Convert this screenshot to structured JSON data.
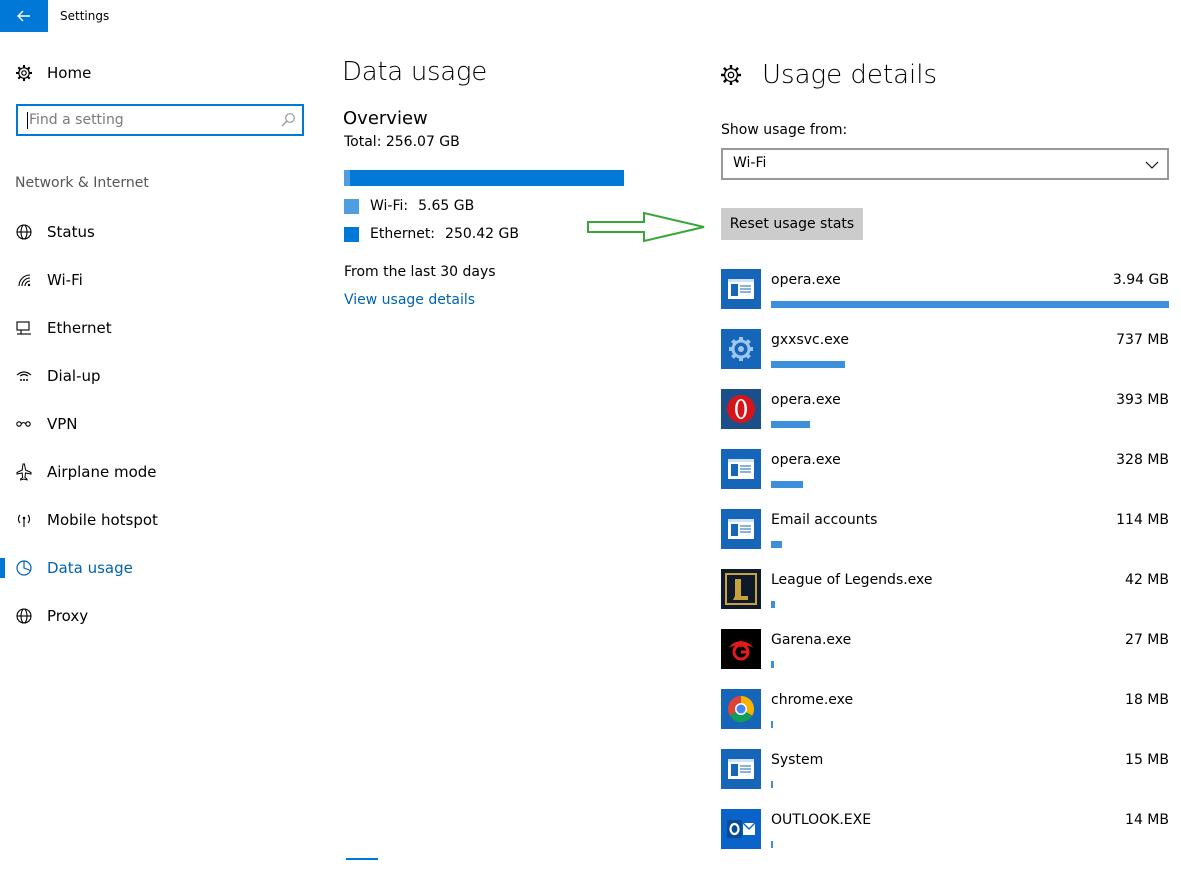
{
  "window": {
    "title": "Settings"
  },
  "nav": {
    "home_label": "Home",
    "search_placeholder": "Find a setting",
    "section_label": "Network & Internet",
    "items": [
      {
        "label": "Status",
        "icon": "globe-icon",
        "active": false
      },
      {
        "label": "Wi-Fi",
        "icon": "wifi-icon",
        "active": false
      },
      {
        "label": "Ethernet",
        "icon": "ethernet-icon",
        "active": false
      },
      {
        "label": "Dial-up",
        "icon": "dialup-icon",
        "active": false
      },
      {
        "label": "VPN",
        "icon": "vpn-icon",
        "active": false
      },
      {
        "label": "Airplane mode",
        "icon": "airplane-icon",
        "active": false
      },
      {
        "label": "Mobile hotspot",
        "icon": "hotspot-icon",
        "active": false
      },
      {
        "label": "Data usage",
        "icon": "pie-chart-icon",
        "active": true
      },
      {
        "label": "Proxy",
        "icon": "globe-icon",
        "active": false
      }
    ]
  },
  "data_usage": {
    "title": "Data usage",
    "overview_label": "Overview",
    "total": "Total: 256.07 GB",
    "wifi_fraction": 0.022,
    "legend": [
      {
        "key": "Wi-Fi:",
        "value": "5.65 GB",
        "color": "#4f9fe0"
      },
      {
        "key": "Ethernet:",
        "value": "250.42 GB",
        "color": "#0078d7"
      }
    ],
    "period": "From the last 30 days",
    "view_details_link": "View usage details"
  },
  "details": {
    "title": "Usage details",
    "show_from_label": "Show usage from:",
    "network_selected": "Wi-Fi",
    "reset_button": "Reset usage stats",
    "apps": [
      {
        "name": "opera.exe",
        "size": "3.94 GB",
        "fraction": 1.0,
        "icon": "window-app-icon"
      },
      {
        "name": "gxxsvc.exe",
        "size": "737 MB",
        "fraction": 0.185,
        "icon": "gear-app-icon"
      },
      {
        "name": "opera.exe",
        "size": "393 MB",
        "fraction": 0.098,
        "icon": "opera-icon"
      },
      {
        "name": "opera.exe",
        "size": "328 MB",
        "fraction": 0.081,
        "icon": "window-app-icon"
      },
      {
        "name": "Email accounts",
        "size": "114 MB",
        "fraction": 0.028,
        "icon": "window-app-icon"
      },
      {
        "name": "League of Legends.exe",
        "size": "42 MB",
        "fraction": 0.01,
        "icon": "league-of-legends-icon"
      },
      {
        "name": "Garena.exe",
        "size": "27 MB",
        "fraction": 0.007,
        "icon": "garena-icon"
      },
      {
        "name": "chrome.exe",
        "size": "18 MB",
        "fraction": 0.005,
        "icon": "chrome-icon"
      },
      {
        "name": "System",
        "size": "15 MB",
        "fraction": 0.004,
        "icon": "window-app-icon"
      },
      {
        "name": "OUTLOOK.EXE",
        "size": "14 MB",
        "fraction": 0.004,
        "icon": "outlook-icon"
      }
    ]
  },
  "colors": {
    "accent": "#0078d7",
    "link": "#0063b1",
    "annotation_arrow": "#3aa63a"
  }
}
